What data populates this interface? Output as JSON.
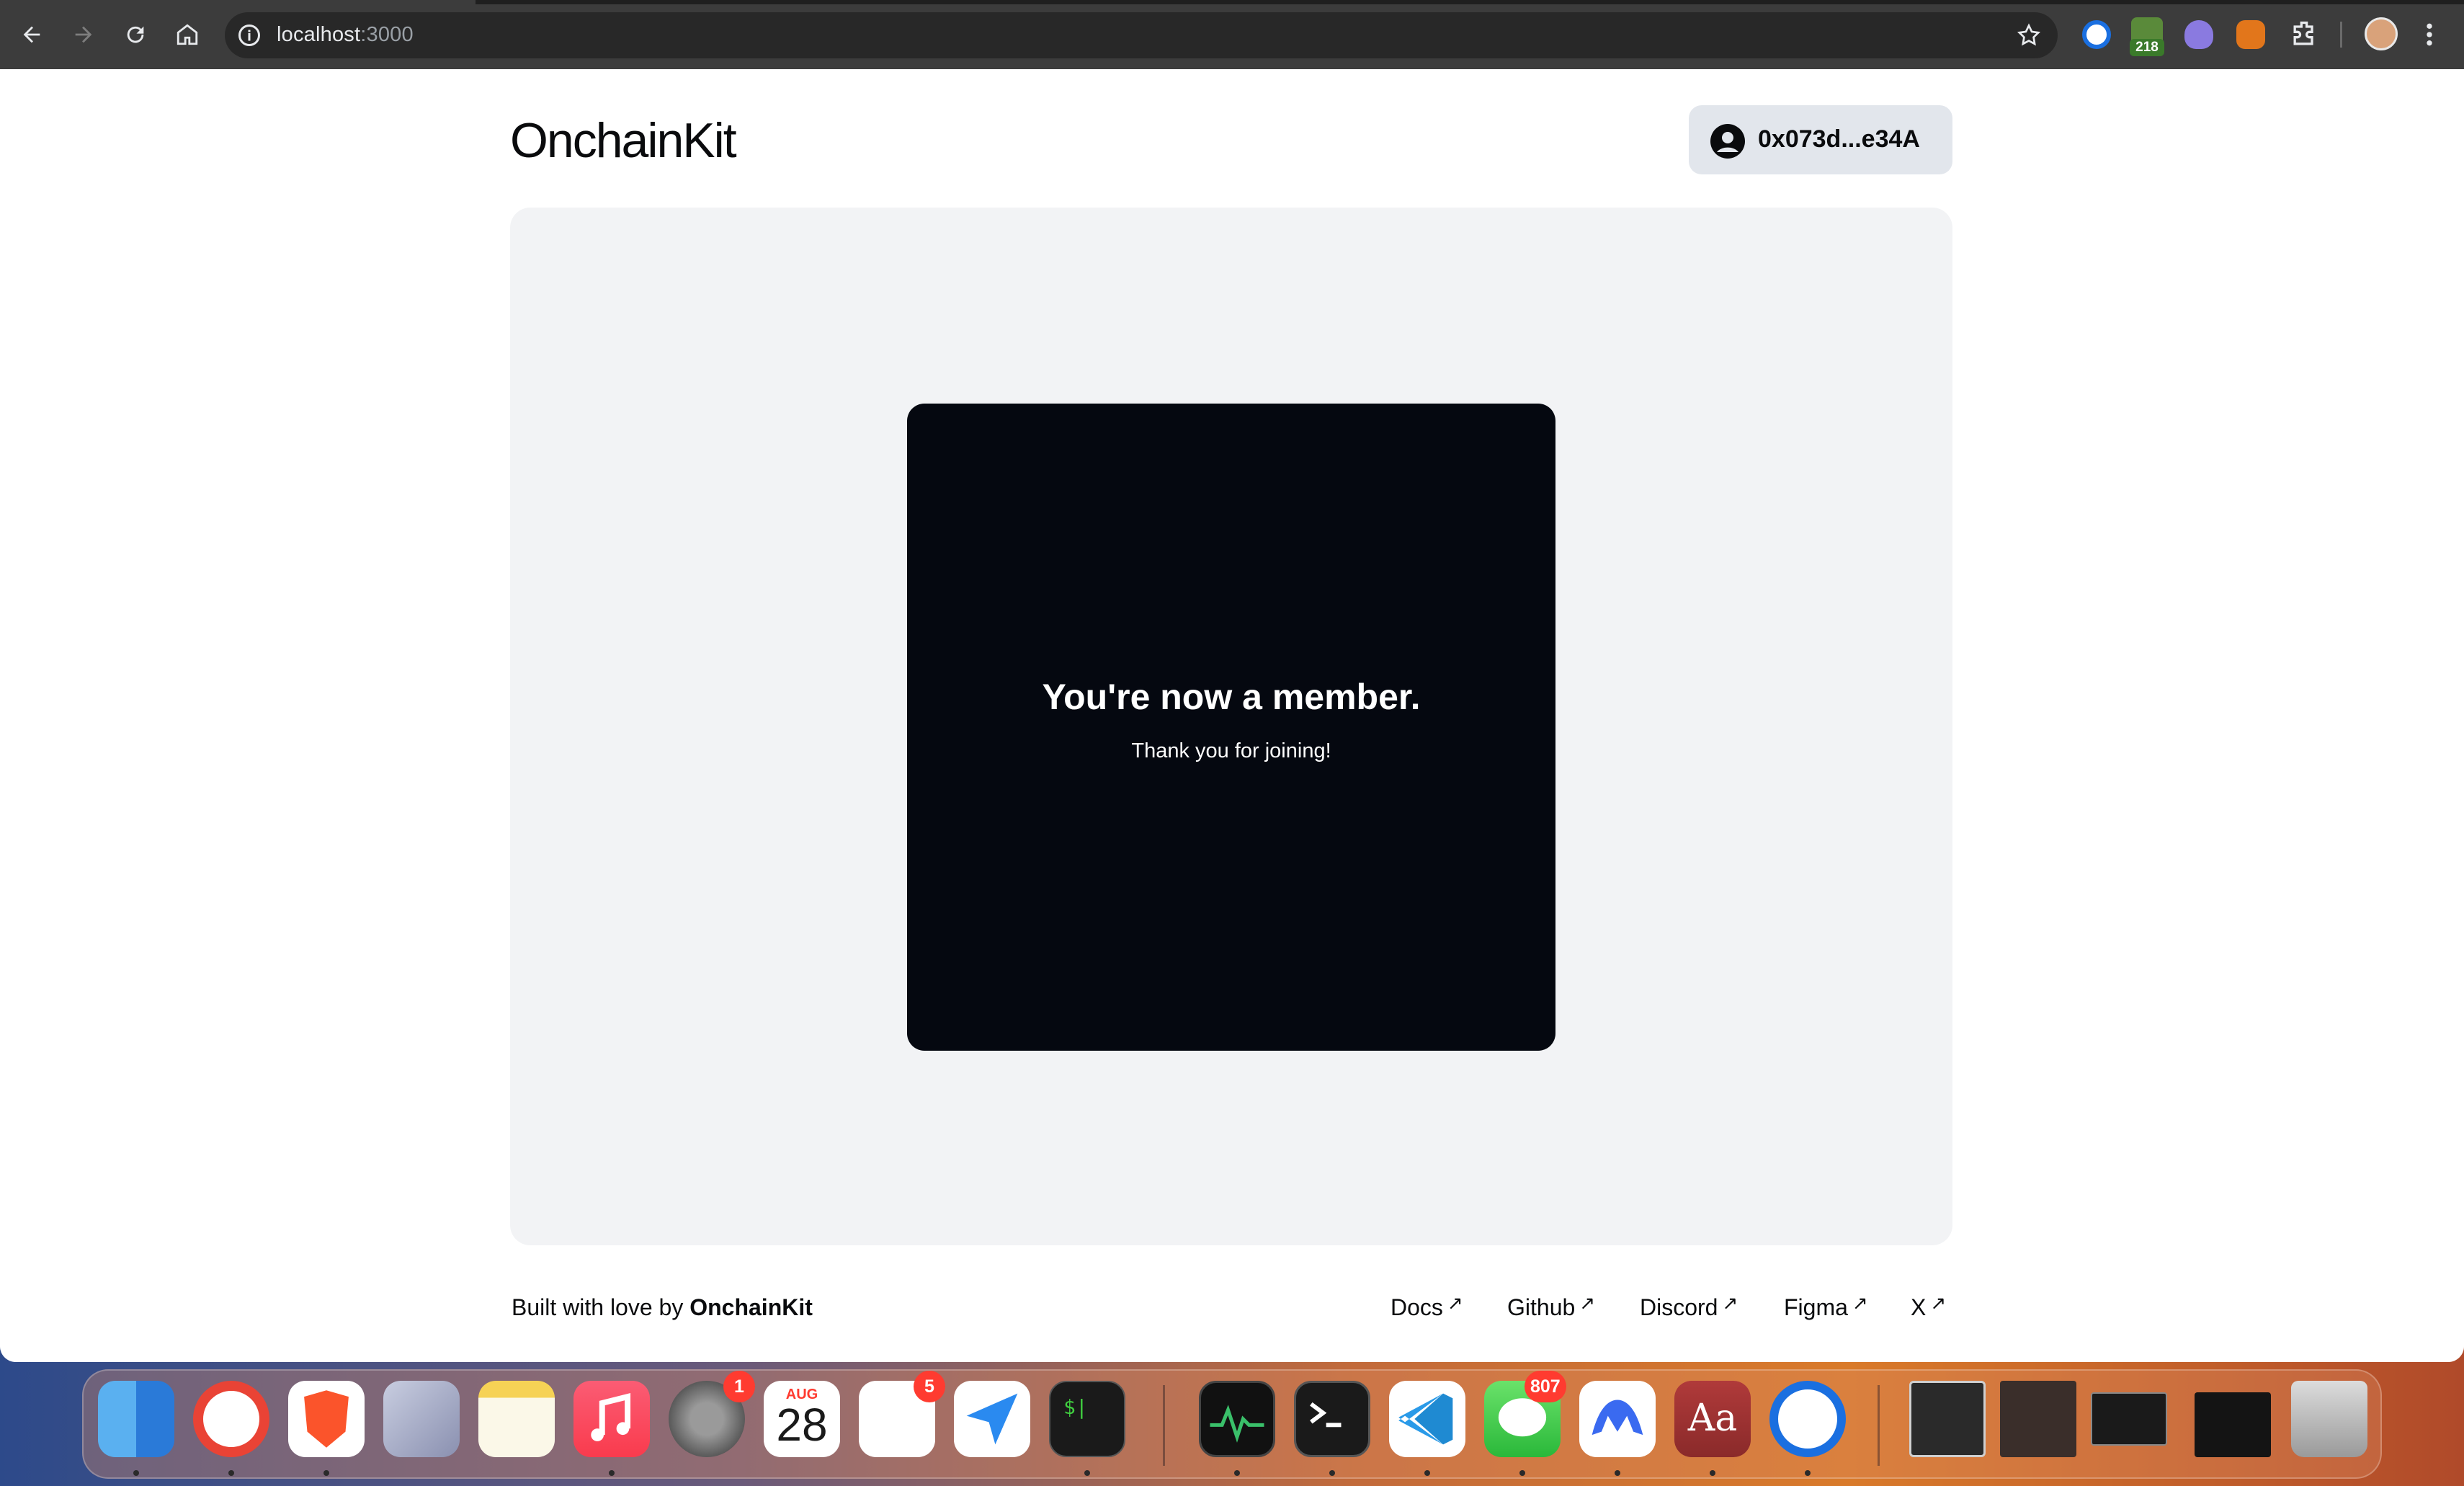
{
  "browser": {
    "url_host": "localhost",
    "url_port": ":3000",
    "extension_badge": "218"
  },
  "header": {
    "brand": "OnchainKit",
    "wallet_address": "0x073d...e34A"
  },
  "card": {
    "headline": "You're now a member.",
    "subtext": "Thank you for joining!"
  },
  "footer": {
    "built_with": "Built with love by ",
    "built_with_brand": "OnchainKit",
    "links": [
      {
        "label": "Docs",
        "arrow": "↗"
      },
      {
        "label": "Github",
        "arrow": "↗"
      },
      {
        "label": "Discord",
        "arrow": "↗"
      },
      {
        "label": "Figma",
        "arrow": "↗"
      },
      {
        "label": "X",
        "arrow": "↗"
      }
    ]
  },
  "dock": {
    "settings_badge": "1",
    "calendar_month": "AUG",
    "calendar_day": "28",
    "reminders_badge": "5",
    "messages_badge": "807",
    "dictionary_label": "Aa",
    "terminal_prompt": "$|"
  },
  "colors": {
    "card_bg": "#050810",
    "panel_bg": "#f2f3f5",
    "wallet_bg": "#e2e6ec"
  }
}
